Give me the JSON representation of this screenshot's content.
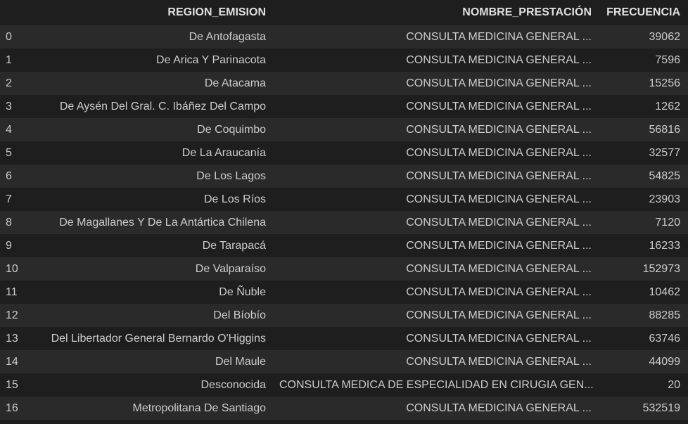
{
  "table": {
    "columns": [
      "",
      "REGION_EMISION",
      "NOMBRE_PRESTACIÓN",
      "FRECUENCIA"
    ],
    "rows": [
      {
        "index": "0",
        "region": "De Antofagasta",
        "prestacion": "CONSULTA MEDICINA GENERAL ...",
        "frecuencia": "39062"
      },
      {
        "index": "1",
        "region": "De Arica Y Parinacota",
        "prestacion": "CONSULTA MEDICINA GENERAL ...",
        "frecuencia": "7596"
      },
      {
        "index": "2",
        "region": "De Atacama",
        "prestacion": "CONSULTA MEDICINA GENERAL ...",
        "frecuencia": "15256"
      },
      {
        "index": "3",
        "region": "De Aysén Del Gral. C. Ibáñez Del Campo",
        "prestacion": "CONSULTA MEDICINA GENERAL ...",
        "frecuencia": "1262"
      },
      {
        "index": "4",
        "region": "De Coquimbo",
        "prestacion": "CONSULTA MEDICINA GENERAL ...",
        "frecuencia": "56816"
      },
      {
        "index": "5",
        "region": "De La Araucanía",
        "prestacion": "CONSULTA MEDICINA GENERAL ...",
        "frecuencia": "32577"
      },
      {
        "index": "6",
        "region": "De Los Lagos",
        "prestacion": "CONSULTA MEDICINA GENERAL ...",
        "frecuencia": "54825"
      },
      {
        "index": "7",
        "region": "De Los Ríos",
        "prestacion": "CONSULTA MEDICINA GENERAL ...",
        "frecuencia": "23903"
      },
      {
        "index": "8",
        "region": "De Magallanes Y De La Antártica Chilena",
        "prestacion": "CONSULTA MEDICINA GENERAL ...",
        "frecuencia": "7120"
      },
      {
        "index": "9",
        "region": "De Tarapacá",
        "prestacion": "CONSULTA MEDICINA GENERAL ...",
        "frecuencia": "16233"
      },
      {
        "index": "10",
        "region": "De Valparaíso",
        "prestacion": "CONSULTA MEDICINA GENERAL ...",
        "frecuencia": "152973"
      },
      {
        "index": "11",
        "region": "De Ñuble",
        "prestacion": "CONSULTA MEDICINA GENERAL ...",
        "frecuencia": "10462"
      },
      {
        "index": "12",
        "region": "Del Bíobío",
        "prestacion": "CONSULTA MEDICINA GENERAL ...",
        "frecuencia": "88285"
      },
      {
        "index": "13",
        "region": "Del Libertador General Bernardo O'Higgins",
        "prestacion": "CONSULTA MEDICINA GENERAL ...",
        "frecuencia": "63746"
      },
      {
        "index": "14",
        "region": "Del Maule",
        "prestacion": "CONSULTA MEDICINA GENERAL ...",
        "frecuencia": "44099"
      },
      {
        "index": "15",
        "region": "Desconocida",
        "prestacion": "CONSULTA MEDICA DE ESPECIALIDAD EN CIRUGIA GEN...",
        "frecuencia": "20"
      },
      {
        "index": "16",
        "region": "Metropolitana De Santiago",
        "prestacion": "CONSULTA MEDICINA GENERAL ...",
        "frecuencia": "532519"
      }
    ]
  },
  "colors": {
    "background": "#1e1e1e",
    "row_stripe": "#2a2a2a",
    "text": "#cccccc",
    "header_text": "#e0e0e0"
  }
}
